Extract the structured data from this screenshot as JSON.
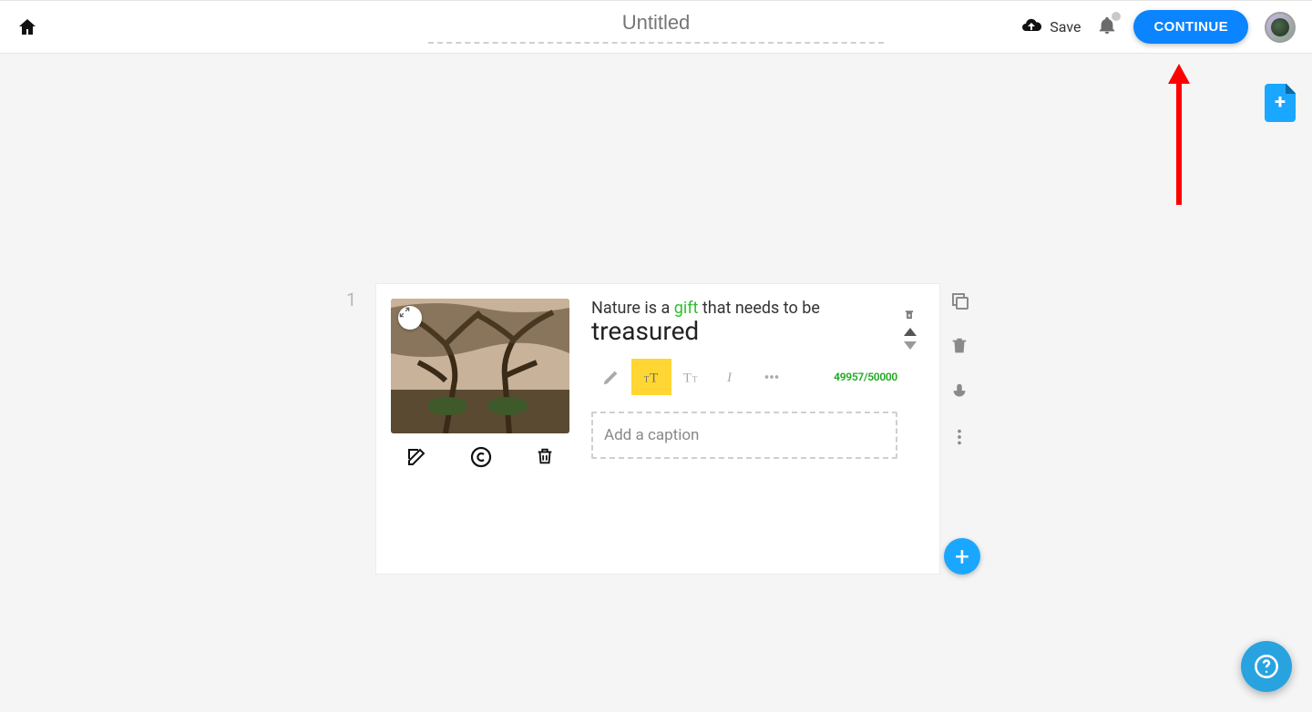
{
  "header": {
    "title_placeholder": "Untitled",
    "save_label": "Save",
    "continue_label": "CONTINUE"
  },
  "slide": {
    "number": "1",
    "text_prefix": "Nature is a ",
    "text_highlight": "gift",
    "text_suffix": " that needs to be",
    "text_emphasis": "treasured",
    "char_count": "49957/50000",
    "caption_placeholder": "Add a caption"
  },
  "icons": {
    "home": "home-icon",
    "cloud_upload": "cloud-upload-icon",
    "bell": "bell-icon",
    "expand": "expand-icon",
    "edit": "edit-square-icon",
    "copyright": "copyright-icon",
    "trash": "trash-icon",
    "copy": "copy-icon",
    "mic": "mic-icon",
    "kebab": "kebab-icon",
    "plus": "plus-icon",
    "help": "help-icon",
    "delete_mini": "delete-mini-icon",
    "pencil_tool": "pencil-icon",
    "textsize_small": "text-small-icon",
    "textsize_large": "text-large-icon",
    "italic": "italic-icon",
    "more": "more-horizontal-icon",
    "add_page": "add-page-icon"
  },
  "colors": {
    "accent": "#0a84ff",
    "accent_light": "#1aa7ff",
    "highlight_yellow": "#ffd633",
    "green_text": "#2fbf2f",
    "annotation_red": "#ff0000"
  }
}
